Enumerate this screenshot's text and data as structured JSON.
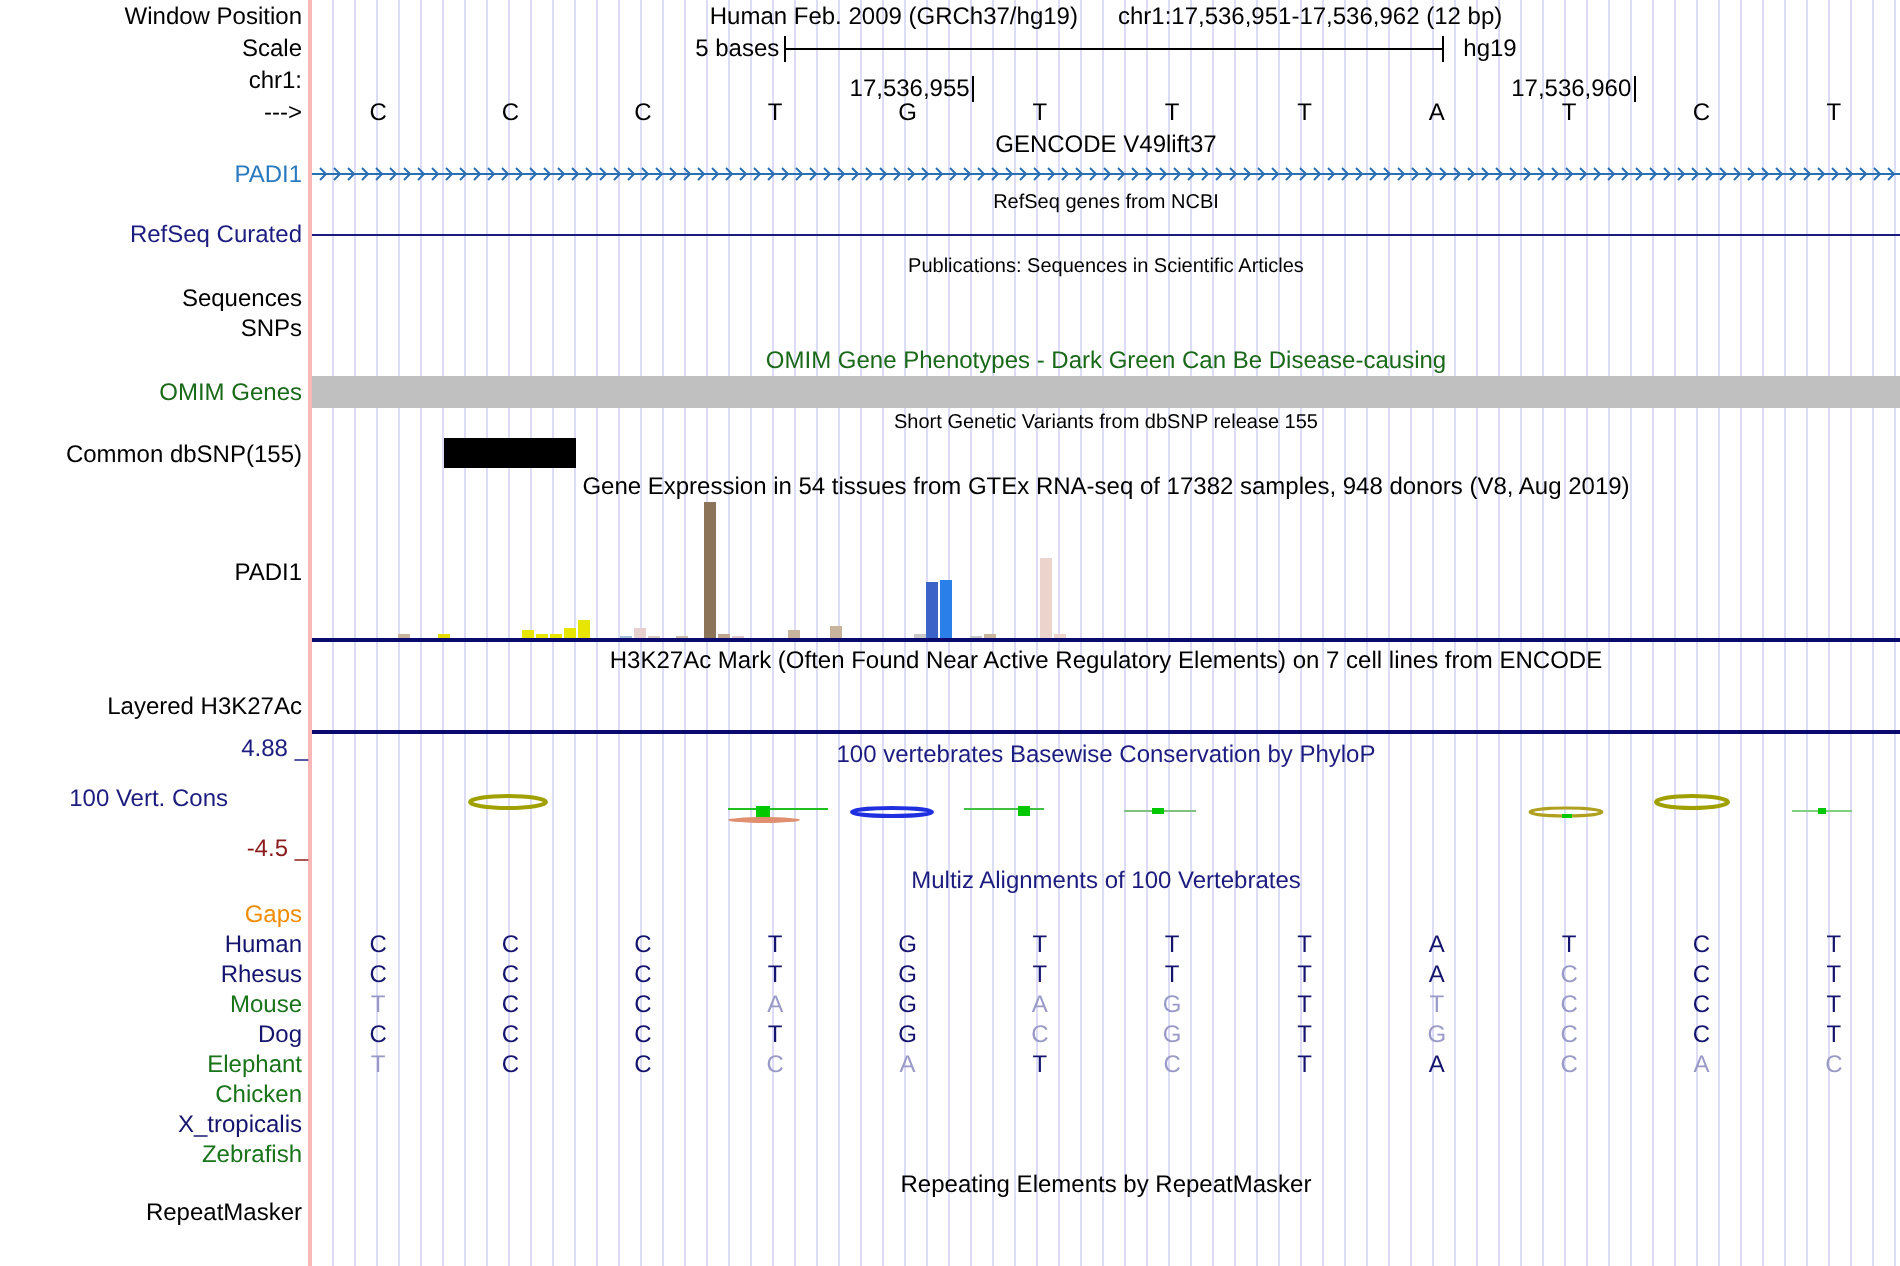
{
  "header": {
    "window_position_label": "Window Position",
    "assembly": "Human Feb. 2009 (GRCh37/hg19)",
    "position": "chr1:17,536,951-17,536,962 (12 bp)",
    "scale_label": "Scale",
    "scale_text": "5 bases",
    "scale_db": "hg19",
    "chrom_label": "chr1:",
    "strand_label": "--->",
    "bases": [
      {
        "base": "C"
      },
      {
        "base": "C"
      },
      {
        "base": "C"
      },
      {
        "base": "T"
      },
      {
        "base": "G",
        "tick": "17,536,955"
      },
      {
        "base": "T"
      },
      {
        "base": "T"
      },
      {
        "base": "T"
      },
      {
        "base": "A"
      },
      {
        "base": "T",
        "tick": "17,536,960"
      },
      {
        "base": "C"
      },
      {
        "base": "T"
      }
    ]
  },
  "tracks": [
    {
      "kind": "gencode",
      "title": "GENCODE V49lift37",
      "label": "PADI1"
    },
    {
      "kind": "refseq",
      "title": "RefSeq genes from NCBI",
      "label": "RefSeq Curated"
    },
    {
      "kind": "publications",
      "title": "Publications: Sequences in Scientific Articles",
      "labels": [
        "Sequences",
        "SNPs"
      ]
    },
    {
      "kind": "omim",
      "title": "OMIM Gene Phenotypes - Dark Green Can Be Disease-causing",
      "label": "OMIM Genes"
    },
    {
      "kind": "snp",
      "title": "Short Genetic Variants from dbSNP release 155",
      "label": "Common dbSNP(155)"
    },
    {
      "kind": "gtex",
      "title": "Gene Expression in 54 tissues from GTEx RNA-seq of 17382 samples, 948 donors (V8, Aug 2019)",
      "label": "PADI1"
    },
    {
      "kind": "h3k27ac",
      "title": "H3K27Ac Mark (Often Found Near Active Regulatory Elements) on 7 cell lines from ENCODE",
      "label": "Layered H3K27Ac"
    },
    {
      "kind": "conservation",
      "title": "100 vertebrates Basewise Conservation by PhyloP",
      "label": "100 Vert. Cons",
      "max": "4.88 _",
      "min": "-4.5 _"
    },
    {
      "kind": "multiz",
      "title": "Multiz Alignments of 100 Vertebrates",
      "gaps_label": "Gaps",
      "species": [
        {
          "name": "Human",
          "color": "#14146e",
          "bases": [
            {
              "b": "C",
              "match": true
            },
            {
              "b": "C",
              "match": true
            },
            {
              "b": "C",
              "match": true
            },
            {
              "b": "T",
              "match": true
            },
            {
              "b": "G",
              "match": true
            },
            {
              "b": "T",
              "match": true
            },
            {
              "b": "T",
              "match": true
            },
            {
              "b": "T",
              "match": true
            },
            {
              "b": "A",
              "match": true
            },
            {
              "b": "T",
              "match": true
            },
            {
              "b": "C",
              "match": true
            },
            {
              "b": "T",
              "match": true
            }
          ]
        },
        {
          "name": "Rhesus",
          "color": "#14146e",
          "bases": [
            {
              "b": "C",
              "match": true
            },
            {
              "b": "C",
              "match": true
            },
            {
              "b": "C",
              "match": true
            },
            {
              "b": "T",
              "match": true
            },
            {
              "b": "G",
              "match": true
            },
            {
              "b": "T",
              "match": true
            },
            {
              "b": "T",
              "match": true
            },
            {
              "b": "T",
              "match": true
            },
            {
              "b": "A",
              "match": true
            },
            {
              "b": "C",
              "match": false
            },
            {
              "b": "C",
              "match": true
            },
            {
              "b": "T",
              "match": true
            }
          ]
        },
        {
          "name": "Mouse",
          "color": "#197319",
          "bases": [
            {
              "b": "T",
              "match": false
            },
            {
              "b": "C",
              "match": true
            },
            {
              "b": "C",
              "match": true
            },
            {
              "b": "A",
              "match": false
            },
            {
              "b": "G",
              "match": true
            },
            {
              "b": "A",
              "match": false
            },
            {
              "b": "G",
              "match": false
            },
            {
              "b": "T",
              "match": true
            },
            {
              "b": "T",
              "match": false
            },
            {
              "b": "C",
              "match": false
            },
            {
              "b": "C",
              "match": true
            },
            {
              "b": "T",
              "match": true
            }
          ]
        },
        {
          "name": "Dog",
          "color": "#14146e",
          "bases": [
            {
              "b": "C",
              "match": true
            },
            {
              "b": "C",
              "match": true
            },
            {
              "b": "C",
              "match": true
            },
            {
              "b": "T",
              "match": true
            },
            {
              "b": "G",
              "match": true
            },
            {
              "b": "C",
              "match": false
            },
            {
              "b": "G",
              "match": false
            },
            {
              "b": "T",
              "match": true
            },
            {
              "b": "G",
              "match": false
            },
            {
              "b": "C",
              "match": false
            },
            {
              "b": "C",
              "match": true
            },
            {
              "b": "T",
              "match": true
            }
          ]
        },
        {
          "name": "Elephant",
          "color": "#197319",
          "bases": [
            {
              "b": "T",
              "match": false
            },
            {
              "b": "C",
              "match": true
            },
            {
              "b": "C",
              "match": true
            },
            {
              "b": "C",
              "match": false
            },
            {
              "b": "A",
              "match": false
            },
            {
              "b": "T",
              "match": true
            },
            {
              "b": "C",
              "match": false
            },
            {
              "b": "T",
              "match": true
            },
            {
              "b": "A",
              "match": true
            },
            {
              "b": "C",
              "match": false
            },
            {
              "b": "A",
              "match": false
            },
            {
              "b": "C",
              "match": false
            }
          ]
        },
        {
          "name": "Chicken",
          "color": "#197319"
        },
        {
          "name": "X_tropicalis",
          "color": "#14146e"
        },
        {
          "name": "Zebrafish",
          "color": "#197319"
        }
      ]
    },
    {
      "kind": "repeatmasker",
      "title": "Repeating Elements by RepeatMasker",
      "label": "RepeatMasker"
    }
  ]
}
